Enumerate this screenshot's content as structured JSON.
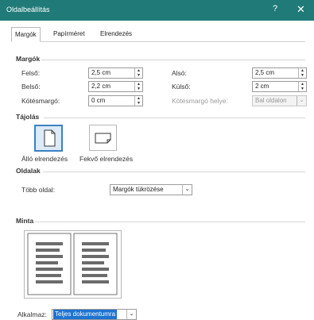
{
  "window": {
    "title": "Oldalbeállítás",
    "help_label": "?",
    "close_label": "✕"
  },
  "tabs": [
    {
      "label": "Margók"
    },
    {
      "label": "Papírméret"
    },
    {
      "label": "Elrendezés"
    }
  ],
  "margins": {
    "section_title": "Margók",
    "top_label": "Felső:",
    "top_value": "2,5 cm",
    "bottom_label": "Alsó:",
    "bottom_value": "2,5 cm",
    "inner_label": "Belső:",
    "inner_value": "2,2 cm",
    "outer_label": "Külső:",
    "outer_value": "2 cm",
    "gutter_label": "Kötésmargó:",
    "gutter_value": "0 cm",
    "gutter_pos_label": "Kötésmargó helye:",
    "gutter_pos_value": "Bal oldalon"
  },
  "orientation": {
    "section_title": "Tájolás",
    "portrait_label": "Álló elrendezés",
    "landscape_label": "Fekvő elrendezés"
  },
  "pages": {
    "section_title": "Oldalak",
    "multiple_label": "Több oldal:",
    "multiple_value": "Margók tükrözése"
  },
  "preview": {
    "section_title": "Minta"
  },
  "apply": {
    "label": "Alkalmaz:",
    "value": "Teljes dokumentumra"
  }
}
